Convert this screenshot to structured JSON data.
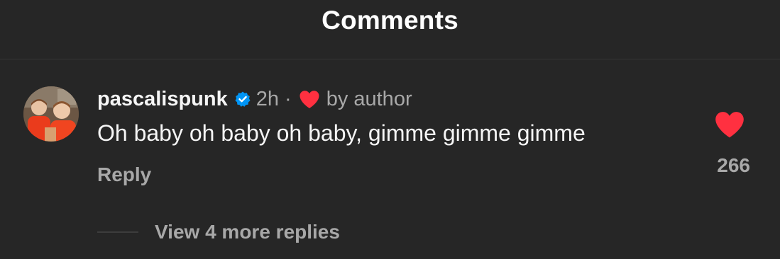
{
  "header": {
    "title": "Comments"
  },
  "comment": {
    "username": "pascalispunk",
    "verified": true,
    "time": "2h",
    "separator": "·",
    "liked_by_author_label": "by author",
    "text": "Oh baby oh baby oh baby, gimme gimme gimme",
    "reply_label": "Reply",
    "like_count": "266",
    "liked": true,
    "view_replies_label": "View 4 more replies"
  },
  "colors": {
    "background": "#262626",
    "primary_text": "#f5f5f5",
    "secondary_text": "#a8a8a8",
    "heart": "#ff3040",
    "verified_badge": "#0095f6"
  },
  "icons": {
    "verified": "verified-badge-icon",
    "author_heart": "heart-filled-icon",
    "like": "heart-filled-icon"
  }
}
